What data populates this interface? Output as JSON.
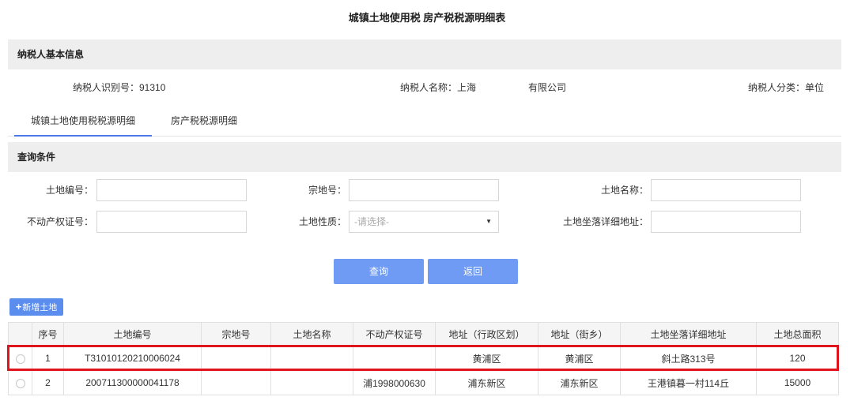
{
  "title": "城镇土地使用税 房产税税源明细表",
  "taxpayer_section": {
    "heading": "纳税人基本信息",
    "id_label": "纳税人识别号：91310",
    "name_label": "纳税人名称：上海",
    "name_suffix": "有限公司",
    "category_label": "纳税人分类：单位"
  },
  "tabs": [
    {
      "label": "城镇土地使用税税源明细",
      "active": true
    },
    {
      "label": "房产税税源明细",
      "active": false
    }
  ],
  "query_section": {
    "heading": "查询条件",
    "fields": {
      "land_no": {
        "label": "土地编号：",
        "value": ""
      },
      "parcel_no": {
        "label": "宗地号：",
        "value": ""
      },
      "land_name": {
        "label": "土地名称：",
        "value": ""
      },
      "property_cert": {
        "label": "不动产权证号：",
        "value": ""
      },
      "land_nature": {
        "label": "土地性质：",
        "placeholder": "-请选择-"
      },
      "land_address": {
        "label": "土地坐落详细地址：",
        "value": ""
      }
    },
    "query_button": "查询",
    "back_button": "返回"
  },
  "add_land_button": "新增土地",
  "table": {
    "headers": [
      "",
      "序号",
      "土地编号",
      "宗地号",
      "土地名称",
      "不动产权证号",
      "地址（行政区划）",
      "地址（街乡）",
      "土地坐落详细地址",
      "土地总面积"
    ],
    "rows": [
      {
        "seq": "1",
        "land_no": "T31010120210006024",
        "parcel_no": "",
        "land_name": "",
        "cert_no": "",
        "district": "黄浦区",
        "street": "黄浦区",
        "address": "斜土路313号",
        "area": "120"
      },
      {
        "seq": "2",
        "land_no": "200711300000041178",
        "parcel_no": "",
        "land_name": "",
        "cert_no": "浦1998000630",
        "district": "浦东新区",
        "street": "浦东新区",
        "address": "王港镇暮一村114丘",
        "area": "15000"
      }
    ]
  },
  "colors": {
    "accent": "#6f9bf4",
    "highlight": "#e0141c",
    "tab_underline": "#4d79e8"
  }
}
